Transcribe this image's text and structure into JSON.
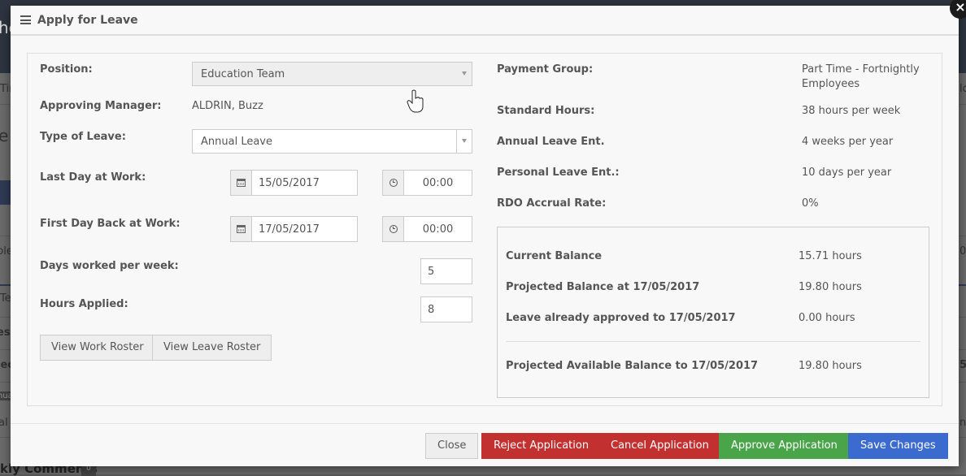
{
  "background": {
    "fragments": [
      "he",
      "Tir",
      "e",
      "ple",
      "Te",
      "esl",
      "iec",
      "nual",
      "al",
      "lo",
      "05",
      "5)",
      "n"
    ],
    "comments_label": "kly Comments",
    "comments_count": "0"
  },
  "modal": {
    "title": "Apply for Leave",
    "close_symbol": "×",
    "left": {
      "position_label": "Position:",
      "position_value": "Education Team",
      "manager_label": "Approving Manager:",
      "manager_value": "ALDRIN, Buzz",
      "leave_type_label": "Type of Leave:",
      "leave_type_value": "Annual Leave",
      "last_day_label": "Last Day at Work:",
      "last_day_date": "15/05/2017",
      "last_day_time": "00:00",
      "first_back_label": "First Day Back at Work:",
      "first_back_date": "17/05/2017",
      "first_back_time": "00:00",
      "days_per_week_label": "Days worked per week:",
      "days_per_week_value": "5",
      "hours_applied_label": "Hours Applied:",
      "hours_applied_value": "8",
      "view_work_roster": "View Work Roster",
      "view_leave_roster": "View Leave Roster"
    },
    "right": {
      "payment_group_label": "Payment Group:",
      "payment_group_value_line1": "Part Time - Fortnightly",
      "payment_group_value_line2": "Employees",
      "standard_hours_label": "Standard Hours:",
      "standard_hours_value": "38 hours per week",
      "annual_ent_label": "Annual Leave Ent.",
      "annual_ent_value": "4 weeks per year",
      "personal_ent_label": "Personal Leave Ent.:",
      "personal_ent_value": "10 days per year",
      "rdo_label": "RDO Accrual Rate:",
      "rdo_value": "0%"
    },
    "balance": {
      "current_label": "Current Balance",
      "current_value": "15.71 hours",
      "projected_label": "Projected Balance at 17/05/2017",
      "projected_value": "19.80 hours",
      "approved_label": "Leave already approved to 17/05/2017",
      "approved_value": "0.00 hours",
      "available_label": "Projected Available Balance to 17/05/2017",
      "available_value": "19.80 hours"
    },
    "footer": {
      "close": "Close",
      "reject": "Reject Application",
      "cancel": "Cancel Application",
      "approve": "Approve Application",
      "save": "Save Changes"
    },
    "colors": {
      "reject": "#c23030",
      "cancel": "#c23030",
      "approve": "#4aa54a",
      "save": "#3c6bcf"
    }
  }
}
